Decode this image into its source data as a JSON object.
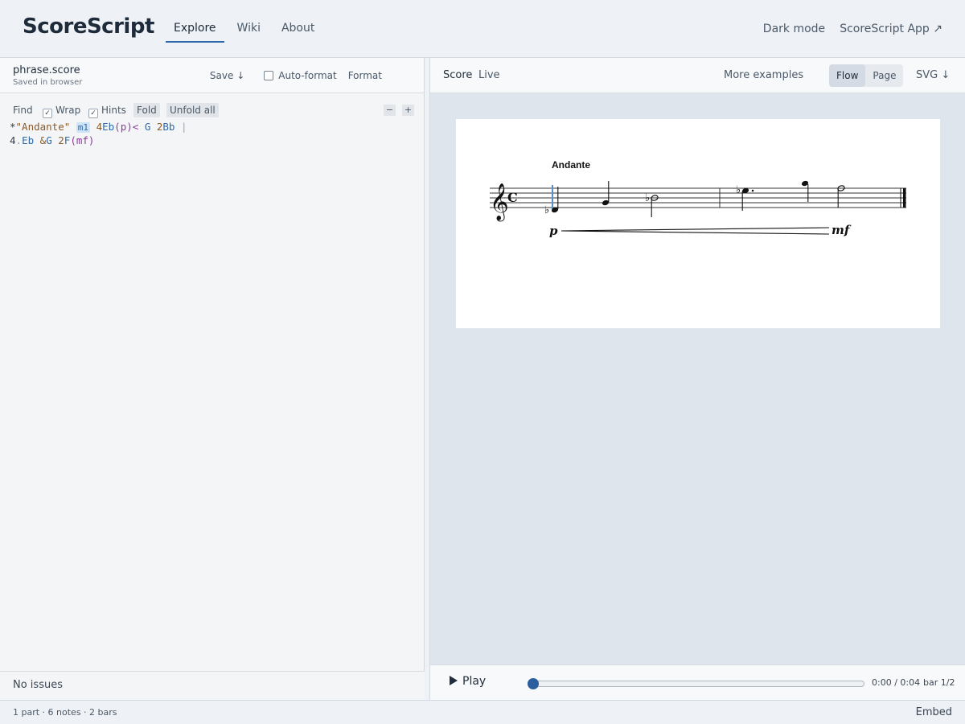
{
  "header": {
    "brand": "ScoreScript",
    "nav": [
      {
        "label": "Explore",
        "active": true
      },
      {
        "label": "Wiki",
        "active": false
      },
      {
        "label": "About",
        "active": false
      }
    ],
    "dark_mode": "Dark mode",
    "app_link": "ScoreScript App ↗"
  },
  "editor": {
    "file_name": "phrase.score",
    "file_status": "Saved in browser",
    "save_label": "Save ↓",
    "auto_format_label": "Auto-format",
    "auto_format_checked": false,
    "format_label": "Format",
    "toolbar": {
      "find": "Find",
      "wrap": "Wrap",
      "hints": "Hints",
      "fold": "Fold",
      "unfold_all": "Unfold all",
      "decrease": "−",
      "increase": "+"
    },
    "code": {
      "line1": {
        "star": "*",
        "tempo": "\"Andante\"",
        "marker": "m1",
        "n1_dur": "4",
        "n1_pitch": "Eb",
        "dyn1": "(p)<",
        "n2": "G",
        "n3_dur": "2",
        "n3_pitch": "Bb",
        "barline": "|"
      },
      "line2": {
        "n4_dur": "4",
        "n4_dot": ".",
        "n4_pitch": "Eb",
        "tie": "&",
        "n5": "G",
        "n6_dur": "2",
        "n6_pitch": "F",
        "dyn2": "(mf)"
      }
    },
    "issues": "No issues"
  },
  "score": {
    "title": "Score",
    "live": "Live",
    "more_examples": "More examples",
    "view_modes": [
      {
        "label": "Flow",
        "active": true
      },
      {
        "label": "Page",
        "active": false
      }
    ],
    "export": "SVG ↓",
    "tempo_marking": "Andante",
    "dynamic_start": "p",
    "dynamic_end": "mf"
  },
  "player": {
    "play_label": "Play",
    "progress": 0,
    "time": "0:00 / 0:04",
    "bar": "bar 1/2"
  },
  "status": {
    "stats": "1 part · 6 notes · 2 bars",
    "embed": "Embed"
  },
  "colors": {
    "accent": "#2f6aa8",
    "thumb": "#2a5e9e",
    "dynamic": "#8a3d9a",
    "string": "#8a5a2b"
  }
}
